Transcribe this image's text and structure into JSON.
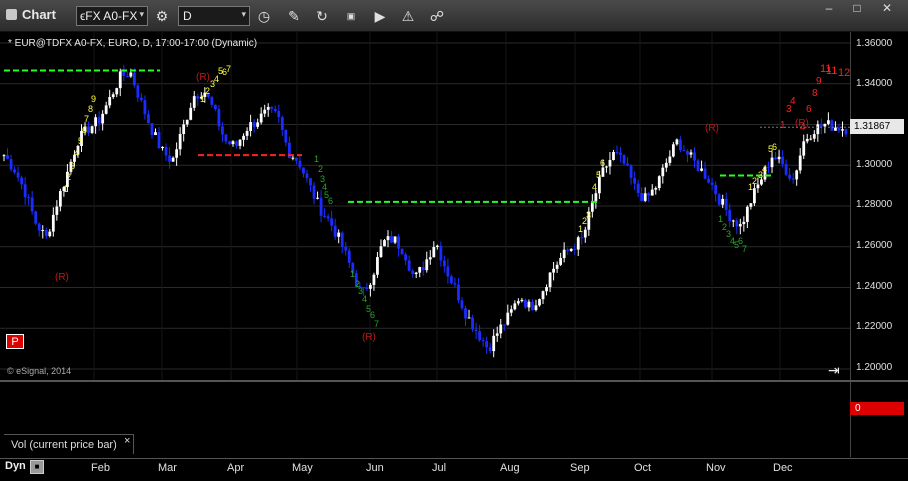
{
  "app": {
    "title": "Chart"
  },
  "toolbar": {
    "symbol": "ϵFX A0-FX",
    "interval": "D",
    "dropdown_glyph": "▾"
  },
  "chart": {
    "title": "* EUR@TDFX A0-FX, EURO, D, 17:00-17:00 (Dynamic)",
    "copyright": "© eSignal, 2014",
    "last_price": "1.31867",
    "p_badge": "P"
  },
  "price_axis": {
    "ticks": [
      "1.36000",
      "1.34000",
      "1.32000",
      "1.30000",
      "1.28000",
      "1.26000",
      "1.24000",
      "1.22000",
      "1.20000"
    ]
  },
  "volume_pane": {
    "label": "Vol (current price bar)",
    "close": "×",
    "value": "0"
  },
  "bottom": {
    "dyn": "Dyn",
    "months": [
      "Feb",
      "Mar",
      "Apr",
      "May",
      "Jun",
      "Jul",
      "Aug",
      "Sep",
      "Oct",
      "Nov",
      "Dec"
    ]
  },
  "colors": {
    "up": "#ffffff",
    "down": "#1a2cff",
    "setup_buy": "#ffff40",
    "setup_sell": "#22aa22",
    "countdown": "#ff2020",
    "resist": "#22ff22",
    "support": "#ff2020"
  },
  "chart_data": {
    "type": "candlestick",
    "title": "* EUR@TDFX A0-FX, EURO, D, 17:00-17:00 (Dynamic)",
    "ylim": [
      1.2,
      1.36
    ],
    "yticks": [
      1.36,
      1.34,
      1.32,
      1.3,
      1.28,
      1.26,
      1.24,
      1.22,
      1.2
    ],
    "x_labels": [
      "Feb",
      "Mar",
      "Apr",
      "May",
      "Jun",
      "Jul",
      "Aug",
      "Sep",
      "Oct",
      "Nov",
      "Dec"
    ],
    "close_path": [
      1.305,
      1.298,
      1.287,
      1.272,
      1.264,
      1.281,
      1.296,
      1.312,
      1.318,
      1.322,
      1.332,
      1.343,
      1.346,
      1.331,
      1.318,
      1.307,
      1.302,
      1.318,
      1.334,
      1.337,
      1.326,
      1.312,
      1.309,
      1.318,
      1.322,
      1.326,
      1.324,
      1.307,
      1.302,
      1.29,
      1.279,
      1.272,
      1.262,
      1.249,
      1.236,
      1.246,
      1.262,
      1.264,
      1.258,
      1.244,
      1.252,
      1.263,
      1.249,
      1.238,
      1.226,
      1.218,
      1.21,
      1.219,
      1.226,
      1.236,
      1.23,
      1.237,
      1.248,
      1.255,
      1.26,
      1.264,
      1.283,
      1.298,
      1.306,
      1.3,
      1.288,
      1.283,
      1.29,
      1.302,
      1.312,
      1.305,
      1.299,
      1.293,
      1.283,
      1.275,
      1.27,
      1.283,
      1.294,
      1.305,
      1.3,
      1.293,
      1.312,
      1.318,
      1.32,
      1.319,
      1.318
    ],
    "last_price": 1.31867,
    "horizontal_lines": [
      {
        "color": "green",
        "y": 1.3465
      },
      {
        "color": "red",
        "y": 1.305
      },
      {
        "color": "green",
        "y": 1.282
      },
      {
        "color": "green",
        "y": 1.295
      }
    ],
    "annotations": [
      "(R)",
      "(R)",
      "(R)",
      "(R)",
      "(R)",
      "1",
      "2",
      "3",
      "4",
      "5",
      "6",
      "7",
      "8",
      "9",
      "11",
      "12"
    ]
  }
}
